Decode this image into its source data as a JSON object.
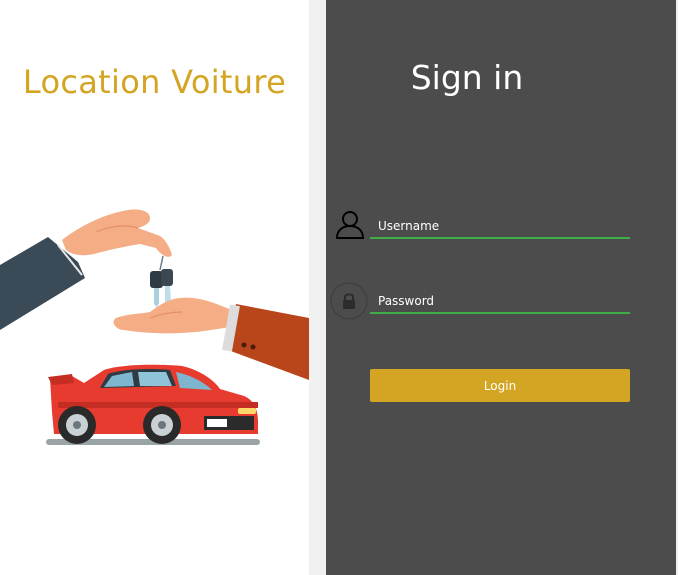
{
  "app": {
    "title": "Location Voiture"
  },
  "signin": {
    "title": "Sign in",
    "username_placeholder": "Username",
    "password_placeholder": "Password",
    "login_label": "Login"
  },
  "icons": {
    "user": "user-icon",
    "lock": "lock-icon",
    "illustration": "car-keys-handover-illustration"
  },
  "colors": {
    "brand_gold": "#d4a523",
    "panel_dark": "#4b4c4b",
    "field_underline": "#3fae49",
    "car_red": "#e63b2e"
  }
}
